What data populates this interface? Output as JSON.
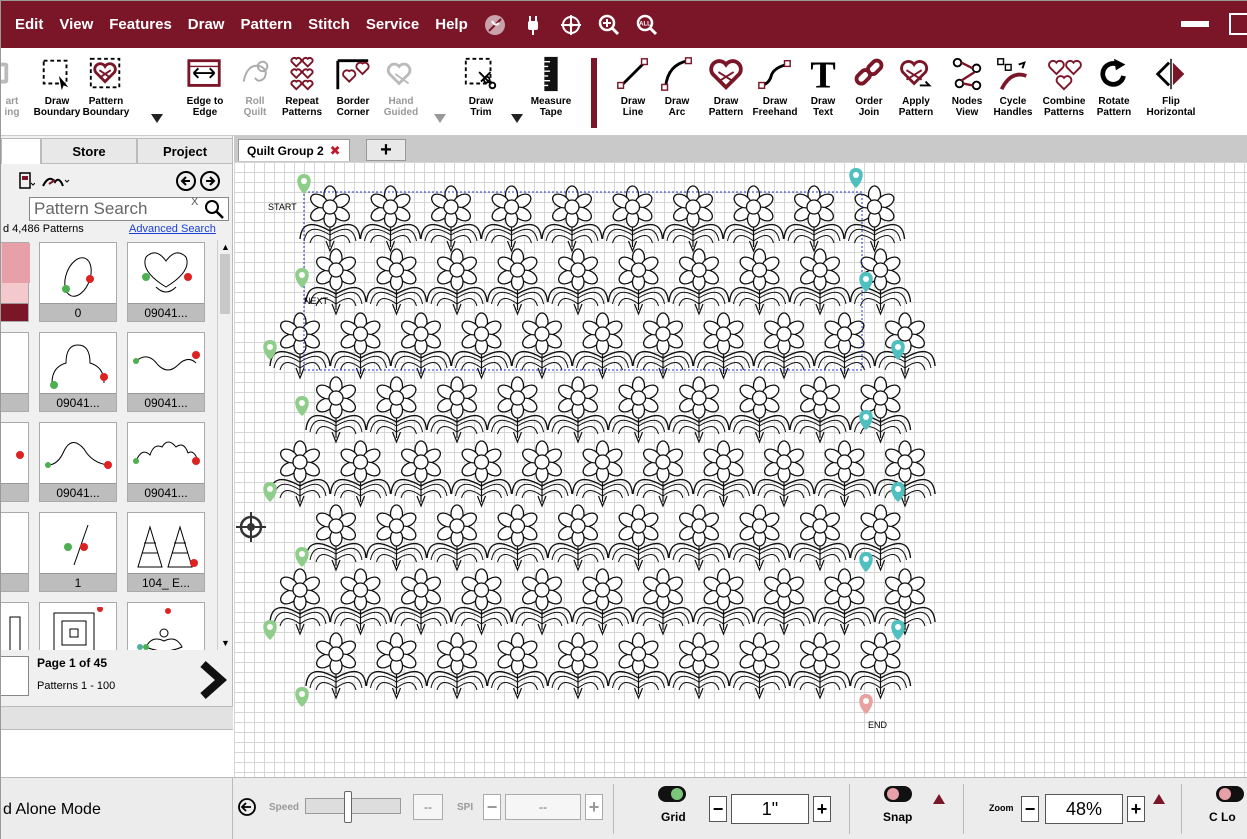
{
  "menu": {
    "items": [
      "Edit",
      "View",
      "Features",
      "Draw",
      "Pattern",
      "Stitch",
      "Service",
      "Help"
    ],
    "icons": [
      "no-design-icon",
      "plug-icon",
      "crosshair-icon",
      "zoom-in-icon",
      "zoom-all-icon"
    ],
    "zoom_all_text": "ALL"
  },
  "toolbar": {
    "start_label": "art\ning",
    "draw_boundary": "Draw\nBoundary",
    "pattern_boundary": "Pattern\nBoundary",
    "edge_to_edge": "Edge to\nEdge",
    "roll_quilt": "Roll\nQuilt",
    "repeat_patterns": "Repeat\nPatterns",
    "border_corner": "Border\nCorner",
    "hand_guided": "Hand\nGuided",
    "draw_trim": "Draw\nTrim",
    "measure_tape": "Measure\nTape",
    "draw_line": "Draw\nLine",
    "draw_arc": "Draw\nArc",
    "draw_pattern": "Draw\nPattern",
    "draw_freehand": "Draw\nFreehand",
    "draw_text": "Draw\nText",
    "order_join": "Order\nJoin",
    "apply_pattern": "Apply\nPattern",
    "nodes_view": "Nodes\nView",
    "cycle_handles": "Cycle\nHandles",
    "combine_patterns": "Combine\nPatterns",
    "rotate_pattern": "Rotate\nPattern",
    "flip_horizontal": "Flip\nHorizontal"
  },
  "left_panel": {
    "tabs": [
      "Store",
      "Project"
    ],
    "search_placeholder": "Pattern Search",
    "search_clear": "X",
    "count": "d 4,486 Patterns",
    "advanced_search": "Advanced Search",
    "thumbnails": [
      {
        "caption": ""
      },
      {
        "caption": "0"
      },
      {
        "caption": "09041..."
      },
      {
        "caption": ""
      },
      {
        "caption": "09041..."
      },
      {
        "caption": "09041..."
      },
      {
        "caption": ""
      },
      {
        "caption": "09041..."
      },
      {
        "caption": "09041..."
      },
      {
        "caption": ""
      },
      {
        "caption": "1"
      },
      {
        "caption": "104_ E..."
      }
    ],
    "page": "Page 1 of 45",
    "patterns_range": "Patterns 1 - 100"
  },
  "doc_tabs": {
    "active": "Quilt Group 2",
    "close_glyph": "✖",
    "add_glyph": "+"
  },
  "canvas": {
    "start_label": "START",
    "next_label": "NEXT",
    "end_label": "END",
    "rows": 8,
    "flowers_per_row": 10
  },
  "statusbar": {
    "mode": "d Alone Mode",
    "speed_label": "Speed",
    "speed_value": "--",
    "spi_label": "SPI",
    "spi_value": "--",
    "grid_label": "Grid",
    "grid_value": "1\"",
    "snap_label": "Snap",
    "zoom_label": "Zoom",
    "zoom_value": "48%",
    "c_lock_label": "C Lo"
  },
  "colors": {
    "brand": "#7b1528",
    "pin_green": "#8fce8a",
    "pin_teal": "#4fbfbf",
    "pin_red": "#e8a0a0",
    "boundary": "#2233cc"
  }
}
